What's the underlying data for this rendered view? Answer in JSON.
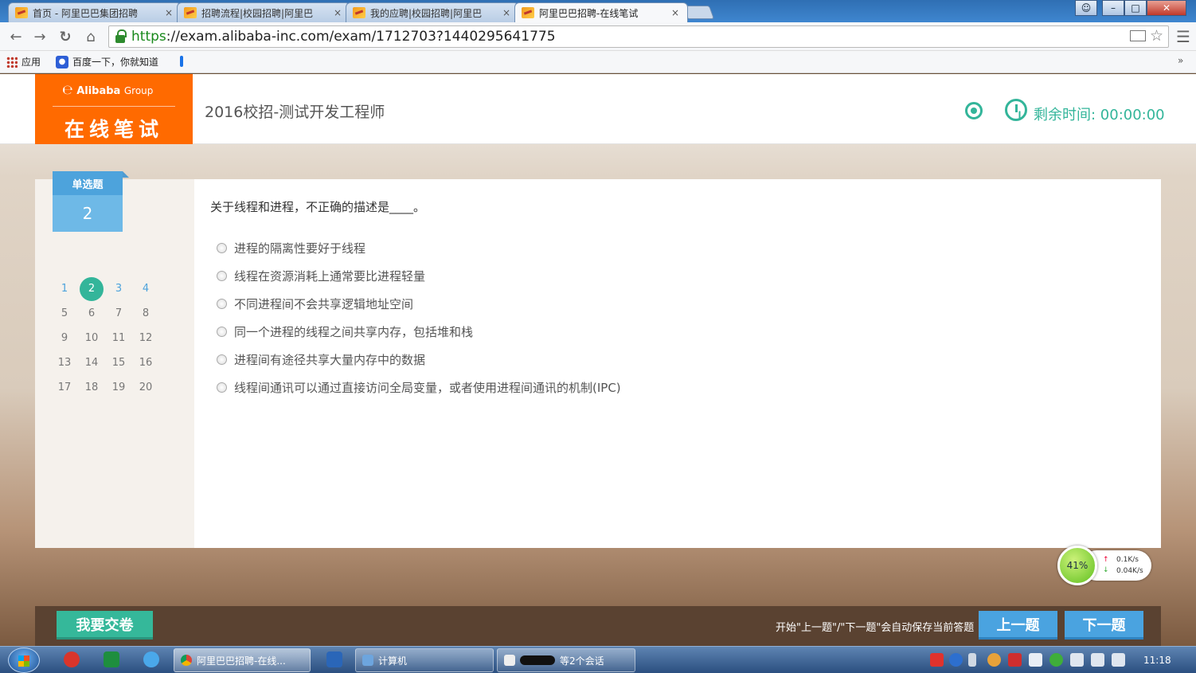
{
  "browser": {
    "tabs": [
      {
        "title": "首页 - 阿里巴巴集团招聘",
        "active": false
      },
      {
        "title": "招聘流程|校园招聘|阿里巴",
        "active": false
      },
      {
        "title": "我的应聘|校园招聘|阿里巴",
        "active": false
      },
      {
        "title": "阿里巴巴招聘-在线笔试",
        "active": true
      }
    ],
    "close_glyph": "×",
    "url_scheme": "https",
    "url_rest": "://exam.alibaba-inc.com/exam/1712703?1440295641775",
    "bookmarks": [
      {
        "label": "应用",
        "icon": "apps-grid-icon"
      },
      {
        "label": "百度一下，你就知道",
        "icon": "baidu-paw-icon"
      }
    ],
    "bookmarks_more": "»"
  },
  "header": {
    "logo_brand": "Alibaba",
    "logo_group": "Group",
    "logo_sub": "在线笔试",
    "exam_title": "2016校招-测试开发工程师",
    "timer_label": "剩余时间: 00:00:00",
    "accent_color": "#33b59a"
  },
  "sidebar": {
    "question_type": "单选题",
    "current_number": "2",
    "numbers": [
      "1",
      "2",
      "3",
      "4",
      "5",
      "6",
      "7",
      "8",
      "9",
      "10",
      "11",
      "12",
      "13",
      "14",
      "15",
      "16",
      "17",
      "18",
      "19",
      "20"
    ],
    "current_index": 1
  },
  "question": {
    "text": "关于线程和进程，不正确的描述是____。",
    "options": [
      "进程的隔离性要好于线程",
      "线程在资源消耗上通常要比进程轻量",
      "不同进程间不会共享逻辑地址空间",
      "同一个进程的线程之间共享内存，包括堆和栈",
      "进程间有途径共享大量内存中的数据",
      "线程间通讯可以通过直接访问全局变量，或者使用进程间通讯的机制(IPC)"
    ]
  },
  "speed_widget": {
    "percent": "41%",
    "up": "0.1K/s",
    "down": "0.04K/s"
  },
  "footer": {
    "submit_label": "我要交卷",
    "hint": "开始\"上一题\"/\"下一题\"会自动保存当前答题",
    "prev_label": "上一题",
    "next_label": "下一题"
  },
  "taskbar": {
    "tasks": [
      "阿里巴巴招聘-在线...",
      "计算机",
      "等2个会话"
    ],
    "time": "11:18"
  }
}
